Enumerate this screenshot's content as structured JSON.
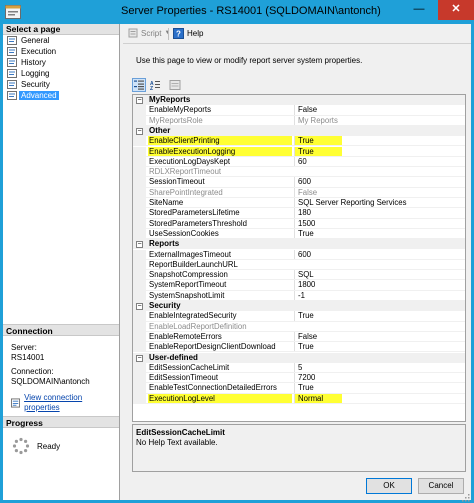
{
  "window": {
    "title": "Server Properties - RS14001 (SQLDOMAIN\\antonch)",
    "minimize_glyph": "—",
    "close_glyph": "✕"
  },
  "left_pane": {
    "header": "Select a page",
    "pages": [
      {
        "label": "General",
        "icon": "page-icon",
        "selected": false
      },
      {
        "label": "Execution",
        "icon": "page-icon",
        "selected": false
      },
      {
        "label": "History",
        "icon": "page-icon",
        "selected": false
      },
      {
        "label": "Logging",
        "icon": "page-icon",
        "selected": false
      },
      {
        "label": "Security",
        "icon": "page-icon",
        "selected": false
      },
      {
        "label": "Advanced",
        "icon": "page-icon",
        "selected": true
      }
    ],
    "connection": {
      "header": "Connection",
      "server_label": "Server:",
      "server_value": "RS14001",
      "connection_label": "Connection:",
      "connection_value": "SQLDOMAIN\\antonch",
      "link_label": "View connection properties",
      "link_icon": "properties-icon"
    },
    "progress": {
      "header": "Progress",
      "status": "Ready",
      "icon": "spinner-icon"
    }
  },
  "toolbar": {
    "script_label": "Script",
    "help_label": "Help"
  },
  "description": "Use this page to view or modify report server system properties.",
  "property_grid": {
    "view_buttons": [
      "categorized-icon",
      "alphabetical-icon",
      "property-pages-icon"
    ],
    "categories": [
      {
        "name": "MyReports",
        "rows": [
          {
            "name": "EnableMyReports",
            "value": "False",
            "dim": false,
            "highlight": false
          },
          {
            "name": "MyReportsRole",
            "value": "My Reports",
            "dim": true,
            "highlight": false
          }
        ]
      },
      {
        "name": "Other",
        "rows": [
          {
            "name": "EnableClientPrinting",
            "value": "True",
            "dim": false,
            "highlight": true
          },
          {
            "name": "EnableExecutionLogging",
            "value": "True",
            "dim": false,
            "highlight": true
          },
          {
            "name": "ExecutionLogDaysKept",
            "value": "60",
            "dim": false,
            "highlight": false
          },
          {
            "name": "RDLXReportTimeout",
            "value": "",
            "dim": true,
            "highlight": false
          },
          {
            "name": "SessionTimeout",
            "value": "600",
            "dim": false,
            "highlight": false
          },
          {
            "name": "SharePointIntegrated",
            "value": "False",
            "dim": true,
            "highlight": false
          },
          {
            "name": "SiteName",
            "value": "SQL Server Reporting Services",
            "dim": false,
            "highlight": false
          },
          {
            "name": "StoredParametersLifetime",
            "value": "180",
            "dim": false,
            "highlight": false
          },
          {
            "name": "StoredParametersThreshold",
            "value": "1500",
            "dim": false,
            "highlight": false
          },
          {
            "name": "UseSessionCookies",
            "value": "True",
            "dim": false,
            "highlight": false
          }
        ]
      },
      {
        "name": "Reports",
        "rows": [
          {
            "name": "ExternalImagesTimeout",
            "value": "600",
            "dim": false,
            "highlight": false
          },
          {
            "name": "ReportBuilderLaunchURL",
            "value": "",
            "dim": false,
            "highlight": false
          },
          {
            "name": "SnapshotCompression",
            "value": "SQL",
            "dim": false,
            "highlight": false
          },
          {
            "name": "SystemReportTimeout",
            "value": "1800",
            "dim": false,
            "highlight": false
          },
          {
            "name": "SystemSnapshotLimit",
            "value": "-1",
            "dim": false,
            "highlight": false
          }
        ]
      },
      {
        "name": "Security",
        "rows": [
          {
            "name": "EnableIntegratedSecurity",
            "value": "True",
            "dim": false,
            "highlight": false
          },
          {
            "name": "EnableLoadReportDefinition",
            "value": "",
            "dim": true,
            "highlight": false
          },
          {
            "name": "EnableRemoteErrors",
            "value": "False",
            "dim": false,
            "highlight": false
          },
          {
            "name": "EnableReportDesignClientDownload",
            "value": "True",
            "dim": false,
            "highlight": false
          }
        ]
      },
      {
        "name": "User-defined",
        "rows": [
          {
            "name": "EditSessionCacheLimit",
            "value": "5",
            "dim": false,
            "highlight": false
          },
          {
            "name": "EditSessionTimeout",
            "value": "7200",
            "dim": false,
            "highlight": false
          },
          {
            "name": "EnableTestConnectionDetailedErrors",
            "value": "True",
            "dim": false,
            "highlight": false
          },
          {
            "name": "ExecutionLogLevel",
            "value": "Normal",
            "dim": false,
            "highlight": true
          }
        ]
      }
    ],
    "expander_glyph": "−"
  },
  "help_panel": {
    "title": "EditSessionCacheLimit",
    "text": "No Help Text available."
  },
  "buttons": {
    "ok": "OK",
    "cancel": "Cancel"
  },
  "colors": {
    "title_bar": "#1fa0d8",
    "close_button": "#c7392b",
    "selection": "#3399ff",
    "highlight": "#ffff33",
    "link": "#0645ad"
  }
}
